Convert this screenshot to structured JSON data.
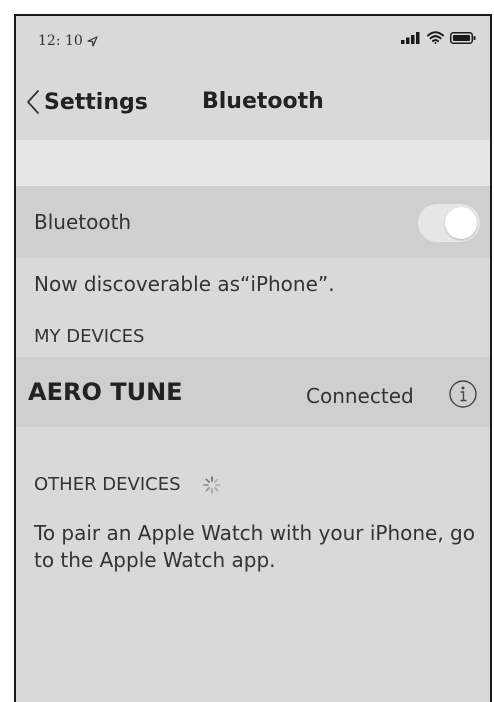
{
  "status_bar": {
    "time": "12: 10"
  },
  "nav": {
    "back_label": "Settings",
    "title": "Bluetooth"
  },
  "bluetooth": {
    "label": "Bluetooth",
    "enabled": true
  },
  "discoverable_text": "Now discoverable as“iPhone”.",
  "my_devices": {
    "header": "MY DEVICES",
    "devices": [
      {
        "name": "AERO TUNE",
        "status": "Connected"
      }
    ]
  },
  "other_devices": {
    "header": "OTHER DEVICES",
    "hint": "To pair an Apple Watch with your iPhone, go to the Apple Watch app."
  },
  "icons": {
    "location": "location-arrow-icon",
    "signal": "signal-bars-icon",
    "wifi": "wifi-icon",
    "battery": "battery-icon",
    "back": "chevron-left-icon",
    "info": "info-icon",
    "spinner": "loading-spinner-icon"
  }
}
